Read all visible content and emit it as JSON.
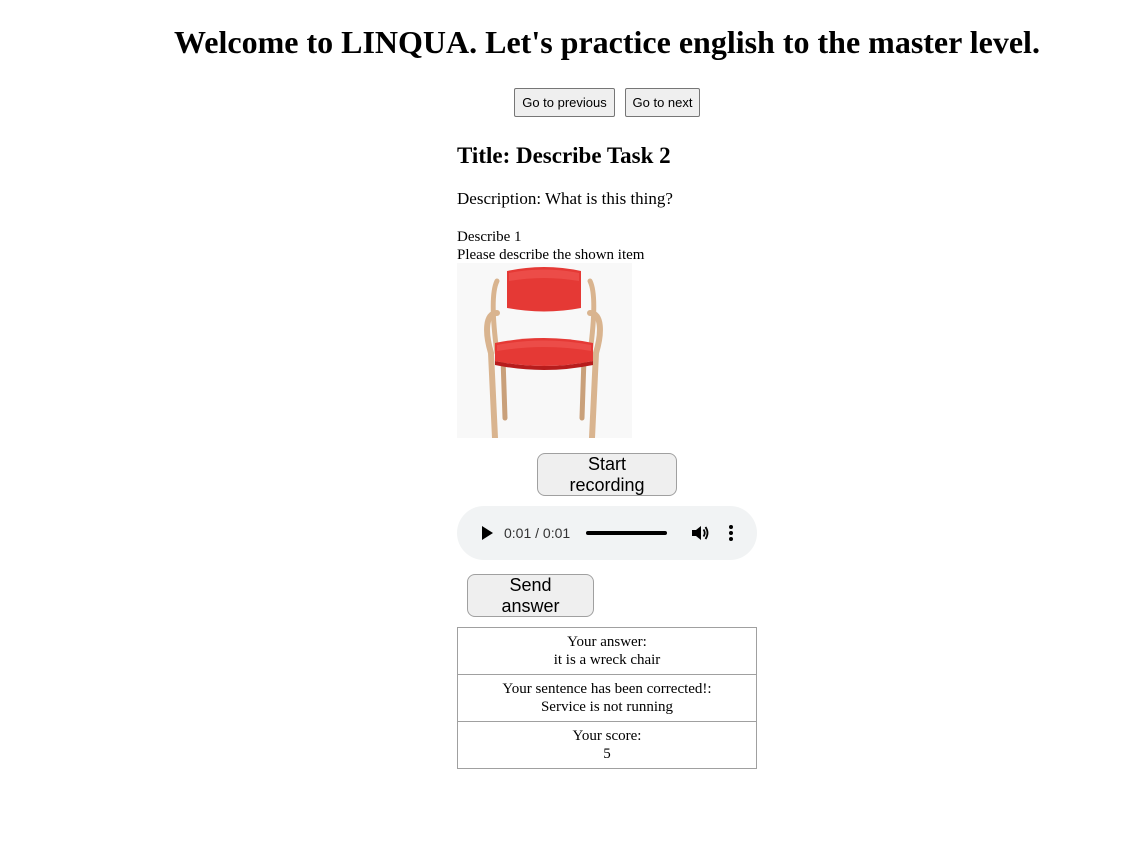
{
  "page": {
    "heading": "Welcome to LINQUA. Let's practice english to the master level."
  },
  "nav": {
    "previous_label": "Go to previous",
    "next_label": "Go to next"
  },
  "task": {
    "title": "Title: Describe Task 2",
    "description": "Description: What is this thing?",
    "question_name": "Describe 1",
    "question_prompt": "Please describe the shown item",
    "image_subject": "red chair with wooden legs"
  },
  "recording": {
    "start_label": "Start recording"
  },
  "audio": {
    "time": "0:01 / 0:01",
    "progress": 1.0,
    "icons": [
      "play-icon",
      "volume-icon",
      "more-options-icon"
    ]
  },
  "send": {
    "label": "Send answer"
  },
  "results": {
    "answer_label": "Your answer:",
    "answer_value": "it is a wreck chair",
    "correction_label": "Your sentence has been corrected!:",
    "correction_value": "Service is not running",
    "score_label": "Your score:",
    "score_value": "5"
  },
  "colors": {
    "chair_red": "#e53935",
    "wood": "#d9b48f",
    "player_bg": "#f1f3f4",
    "button_bg": "#efefef"
  }
}
